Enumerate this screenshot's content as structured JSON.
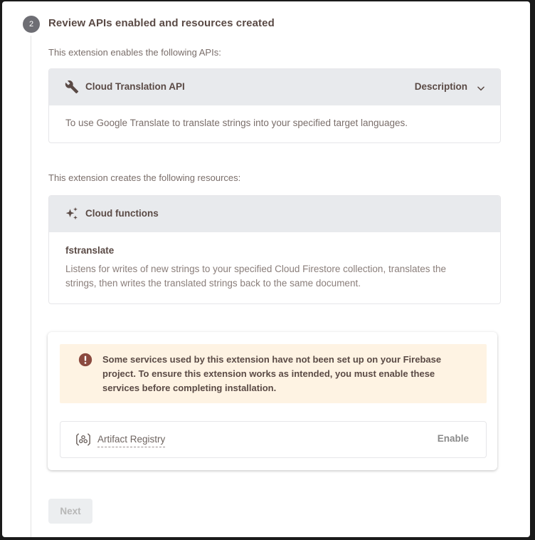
{
  "step": {
    "number": "2",
    "title": "Review APIs enabled and resources created"
  },
  "apis": {
    "intro": "This extension enables the following APIs:",
    "items": [
      {
        "icon": "wrench-icon",
        "name": "Cloud Translation API",
        "toggle_label": "Description",
        "description": "To use Google Translate to translate strings into your specified target languages."
      }
    ]
  },
  "resources": {
    "intro": "This extension creates the following resources:",
    "group": {
      "icon": "sparkle-icon",
      "title": "Cloud functions"
    },
    "items": [
      {
        "name": "fstranslate",
        "description": "Listens for writes of new strings to your specified Cloud Firestore collection, translates the strings, then writes the translated strings back to the same document."
      }
    ]
  },
  "warning": {
    "icon": "error-icon",
    "message": "Some services used by this extension have not been set up on your Firebase project. To ensure this extension works as intended, you must enable these services before completing installation.",
    "services": [
      {
        "icon": "artifact-registry-icon",
        "name": "Artifact Registry",
        "action_label": "Enable"
      }
    ]
  },
  "footer": {
    "next_label": "Next",
    "next_disabled": true
  },
  "colors": {
    "text_primary": "#5a4a45",
    "text_secondary": "#7a6e6a",
    "card_header_bg": "#e8eaed",
    "warning_bg": "#fef3e3",
    "warning_icon": "#8b4a3f",
    "step_circle": "#6e6e74"
  }
}
